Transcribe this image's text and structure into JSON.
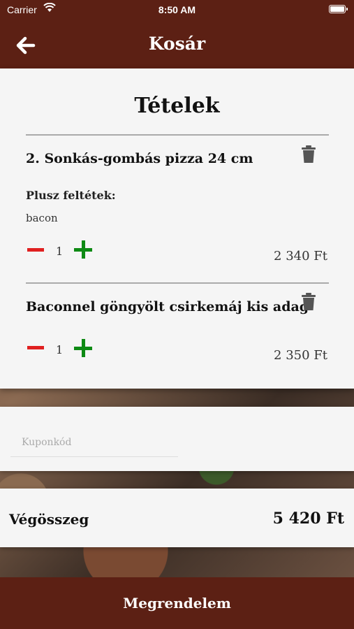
{
  "status_bar": {
    "carrier": "Carrier",
    "time": "8:50 AM"
  },
  "nav": {
    "title": "Kosár",
    "back_icon": "arrow-left-icon"
  },
  "cart": {
    "section_title": "Tételek",
    "items": [
      {
        "name": "2. Sonkás-gombás pizza 24 cm",
        "extras_label": "Plusz feltétek:",
        "extras_value": "bacon",
        "quantity": "1",
        "price": "2 340 Ft"
      },
      {
        "name": "Baconnel göngyölt csirkemáj kis adag",
        "quantity": "1",
        "price": "2 350 Ft"
      }
    ]
  },
  "coupon": {
    "placeholder": "Kuponkód",
    "value": ""
  },
  "total": {
    "label": "Végösszeg",
    "value": "5 420 Ft"
  },
  "order_button": {
    "label": "Megrendelem"
  },
  "colors": {
    "brand": "#5c2014",
    "minus": "#e02020",
    "plus": "#0e8a14",
    "card_bg": "#f5f5f5"
  }
}
